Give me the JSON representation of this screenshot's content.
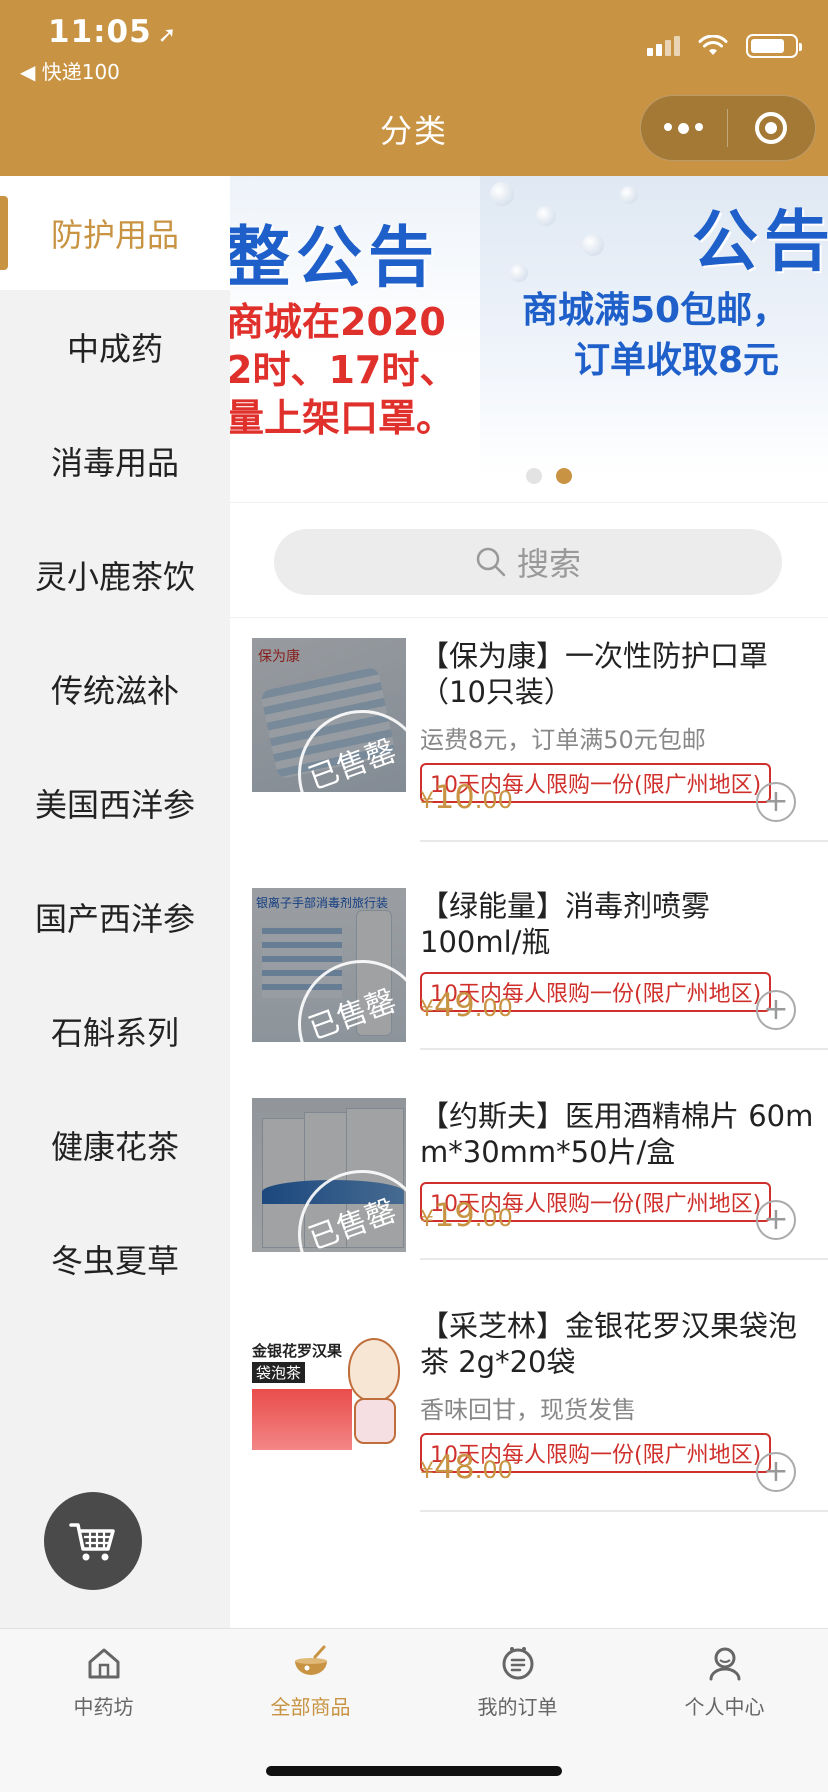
{
  "status_bar": {
    "time": "11:05",
    "back_label": "◀ 快递100"
  },
  "header": {
    "title": "分类"
  },
  "categories": [
    {
      "label": "防护用品",
      "active": true
    },
    {
      "label": "中成药",
      "active": false
    },
    {
      "label": "消毒用品",
      "active": false
    },
    {
      "label": "灵小鹿茶饮",
      "active": false
    },
    {
      "label": "传统滋补",
      "active": false
    },
    {
      "label": "美国西洋参",
      "active": false
    },
    {
      "label": "国产西洋参",
      "active": false
    },
    {
      "label": "石斛系列",
      "active": false
    },
    {
      "label": "健康花茶",
      "active": false
    },
    {
      "label": "冬虫夏草",
      "active": false
    }
  ],
  "banner": {
    "slide_a": {
      "title": "整公告",
      "line1": "商城在2020",
      "line2": "2时、17时、",
      "line3": "量上架口罩。"
    },
    "slide_b": {
      "title": "公告",
      "line1": "商城满50包邮，",
      "line2": "订单收取8元"
    },
    "active_index": 1
  },
  "search": {
    "placeholder": "搜索"
  },
  "products": [
    {
      "name": "【保为康】一次性防护口罩（10只装）",
      "desc": "运费8元，订单满50元包邮",
      "tag": "10天内每人限购一份(限广州地区)",
      "price_int": "10",
      "price_dec": ".00",
      "currency": "¥",
      "sold_out": true,
      "sold_out_label": "已售罄"
    },
    {
      "name": "【绿能量】消毒剂喷雾 100ml/瓶",
      "desc": "",
      "tag": "10天内每人限购一份(限广州地区)",
      "price_int": "49",
      "price_dec": ".00",
      "currency": "¥",
      "sold_out": true,
      "sold_out_label": "已售罄"
    },
    {
      "name": "【约斯夫】医用酒精棉片 60mm*30mm*50片/盒",
      "desc": "",
      "tag": "10天内每人限购一份(限广州地区)",
      "price_int": "19",
      "price_dec": ".00",
      "currency": "¥",
      "sold_out": true,
      "sold_out_label": "已售罄"
    },
    {
      "name": "【采芝林】金银花罗汉果袋泡茶 2g*20袋",
      "desc": "香味回甘，现货发售",
      "tag": "10天内每人限购一份(限广州地区)",
      "price_int": "48",
      "price_dec": ".00",
      "currency": "¥",
      "sold_out": false,
      "sold_out_label": ""
    }
  ],
  "product_images": {
    "p1_brand": "保为康",
    "p2_caption": "银离子手部消毒剂旅行装",
    "p4_caption1": "金银花罗汉果",
    "p4_caption2": "袋泡茶"
  },
  "tabbar": [
    {
      "label": "中药坊",
      "icon": "home-icon",
      "active": false
    },
    {
      "label": "全部商品",
      "icon": "bowl-icon",
      "active": true
    },
    {
      "label": "我的订单",
      "icon": "order-icon",
      "active": false
    },
    {
      "label": "个人中心",
      "icon": "user-icon",
      "active": false
    }
  ],
  "colors": {
    "brand": "#c89443",
    "tag_red": "#d0302b",
    "banner_blue": "#1e5fc9"
  }
}
